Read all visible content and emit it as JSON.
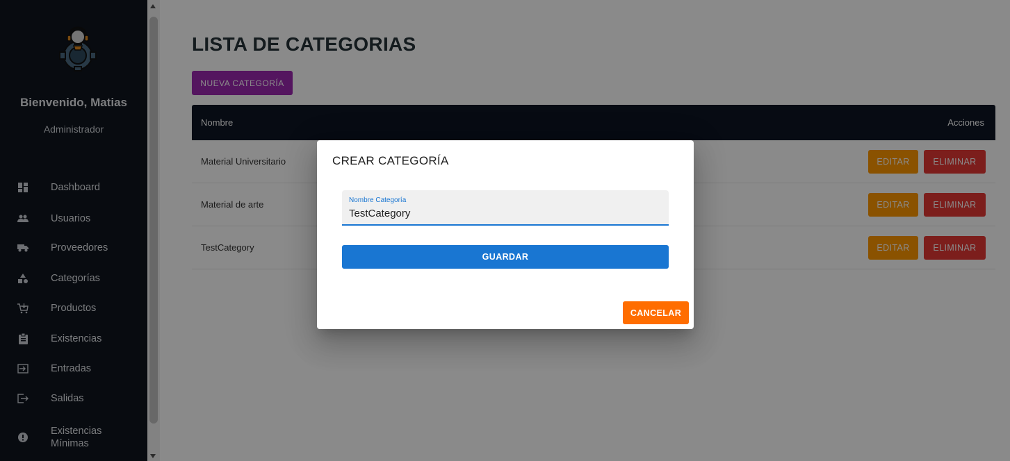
{
  "sidebar": {
    "welcome": "Bienvenido, Matias",
    "role": "Administrador",
    "items": [
      {
        "label": "Dashboard",
        "icon": "dashboard-icon"
      },
      {
        "label": "Usuarios",
        "icon": "users-icon"
      },
      {
        "label": "Proveedores",
        "icon": "truck-icon"
      },
      {
        "label": "Categorías",
        "icon": "category-icon"
      },
      {
        "label": "Productos",
        "icon": "cart-icon"
      },
      {
        "label": "Existencias",
        "icon": "clipboard-icon"
      },
      {
        "label": "Entradas",
        "icon": "input-icon"
      },
      {
        "label": "Salidas",
        "icon": "exit-icon"
      },
      {
        "label": "Existencias Mínimas",
        "icon": "alert-icon"
      }
    ]
  },
  "main": {
    "title": "LISTA DE CATEGORIAS",
    "new_button": "NUEVA CATEGORÍA",
    "table": {
      "headers": {
        "name": "Nombre",
        "actions": "Acciones"
      },
      "rows": [
        {
          "name": "Material Universitario"
        },
        {
          "name": "Material de arte"
        },
        {
          "name": "TestCategory"
        }
      ],
      "edit_label": "EDITAR",
      "delete_label": "ELIMINAR"
    }
  },
  "dialog": {
    "title": "CREAR CATEGORÍA",
    "field_label": "Nombre Categoría",
    "field_value": "TestCategory",
    "save_label": "GUARDAR",
    "cancel_label": "CANCELAR"
  },
  "colors": {
    "sidebar_bg": "#10151f",
    "header_bg": "#0d1524",
    "new_button": "#9c27b0",
    "edit_button": "#ff9800",
    "delete_button": "#e53935",
    "save_button": "#1976d2",
    "cancel_button": "#ff6d00"
  }
}
